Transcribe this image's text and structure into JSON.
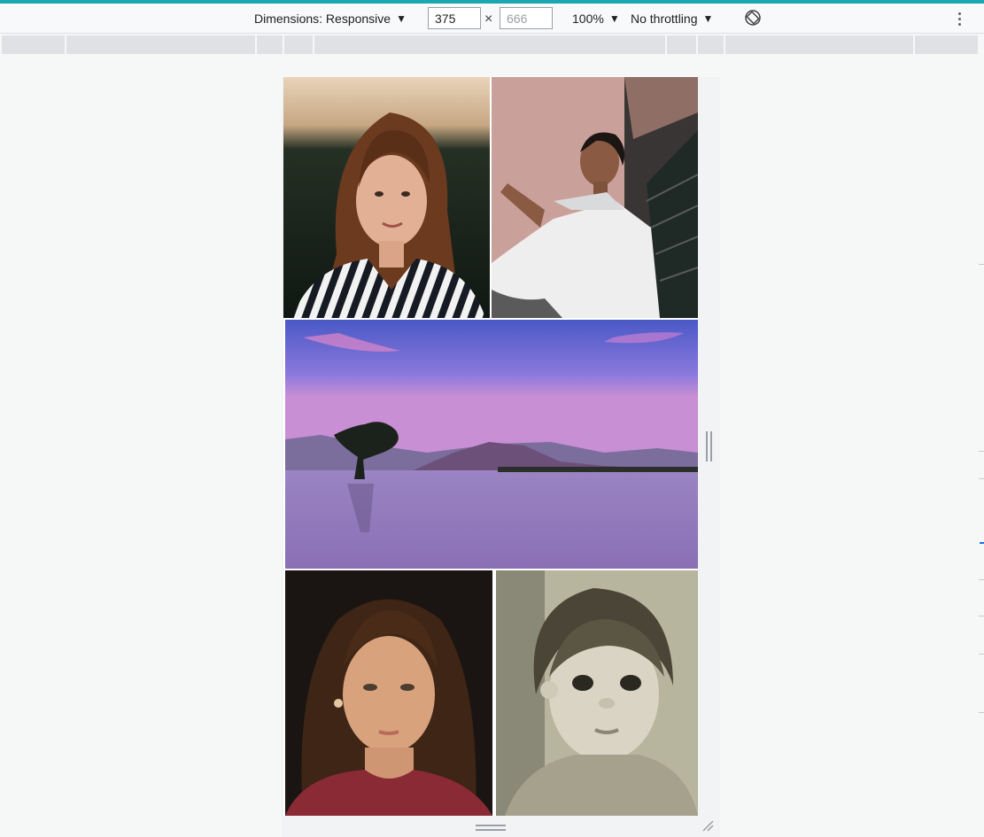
{
  "toolbar": {
    "dimensions_label": "Dimensions: Responsive",
    "width_value": "375",
    "height_placeholder": "666",
    "times_symbol": "×",
    "zoom_label": "100%",
    "throttling_label": "No throttling",
    "caret": "▼"
  },
  "colors": {
    "accent": "#1aa7b0",
    "toolbar_bg": "#f8f9fa",
    "ruler": "#dfe1e5",
    "page_bg": "#f6f8f8"
  },
  "gallery": {
    "images": [
      {
        "name": "woman-striped-shirt-photo"
      },
      {
        "name": "woman-white-tshirt-photo"
      },
      {
        "name": "lake-tree-sunset-photo"
      },
      {
        "name": "woman-curly-hair-portrait-photo"
      },
      {
        "name": "child-sepia-portrait-photo"
      }
    ]
  },
  "icons": [
    "caret-down-icon",
    "rotate-icon",
    "more-options-icon",
    "resize-handle-icon"
  ]
}
